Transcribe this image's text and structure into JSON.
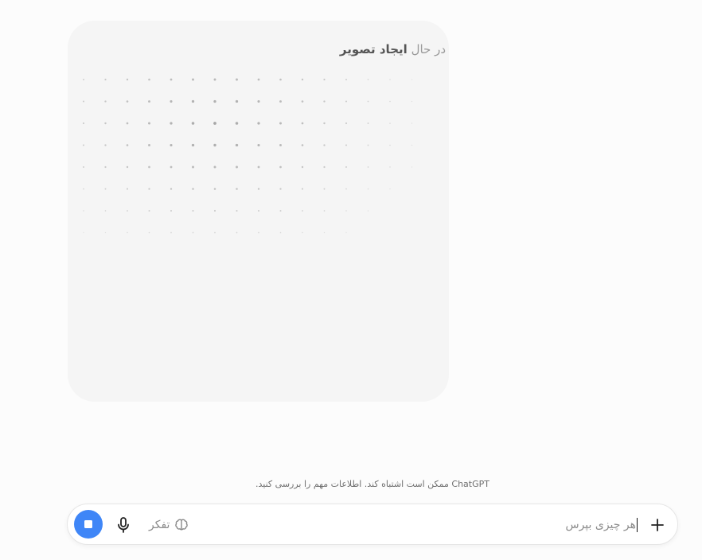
{
  "generation_card": {
    "status_prefix": "در حال",
    "status_main": "ایجاد تصویر"
  },
  "disclaimer": "ChatGPT ممکن است اشتباه کند. اطلاعات مهم را بررسی کنید.",
  "composer": {
    "placeholder": "هر چیزی بپرس",
    "think_label": "تفکر",
    "icons": {
      "stop": "stop-square-icon",
      "mic": "microphone-icon",
      "think": "brain-icon",
      "add": "plus-icon"
    },
    "accent_color": "#3f86f7"
  }
}
